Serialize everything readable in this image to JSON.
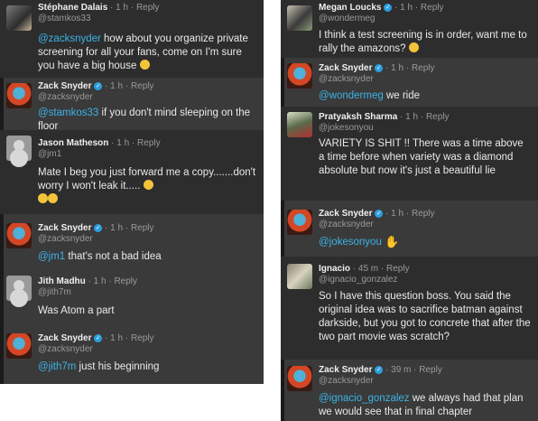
{
  "colors": {
    "background": "#2d2d2d",
    "mention": "#3cb3e8",
    "verified": "#2a9fe0"
  },
  "left": [
    {
      "name": "Stéphane Dalais",
      "meta": " · 1 h · Reply",
      "handle": "@stamkos33",
      "mention": "@zacksnyder",
      "text": "  how about you organize private screening for all your fans, come on I'm sure you have a big house",
      "emoji": "laughing-emoji"
    },
    {
      "name": "Zack Snyder",
      "meta": " · 1 h · Reply",
      "handle": "@zacksnyder",
      "mention": "@stamkos33",
      "text": " if you don't mind sleeping on the floor"
    },
    {
      "name": "Jason Matheson",
      "meta": " · 1 h · Reply",
      "handle": "@jm1",
      "text": "Mate I beg you just forward me a copy.......don't worry I won't leak it.....",
      "emoji": "laughing-emoji"
    },
    {
      "name": "Zack Snyder",
      "meta": " · 1 h · Reply",
      "handle": "@zacksnyder",
      "mention": "@jm1",
      "text": " that's not a bad idea"
    },
    {
      "name": "Jith Madhu",
      "meta": " · 1 h · Reply",
      "handle": "@jith7m",
      "text": "Was Atom a part"
    },
    {
      "name": "Zack Snyder",
      "meta": " · 1 h · Reply",
      "handle": "@zacksnyder",
      "mention": "@jith7m",
      "text": " just his beginning"
    }
  ],
  "right": [
    {
      "name": "Megan Loucks",
      "meta": " · 1 h · Reply",
      "handle": "@wondermeg",
      "text": "I think a test screening is in order, want me to rally the amazons?",
      "emoji": "smirk-emoji"
    },
    {
      "name": "Zack Snyder",
      "meta": " · 1 h · Reply",
      "handle": "@zacksnyder",
      "mention": "@wondermeg",
      "text": " we ride"
    },
    {
      "name": "Pratyaksh Sharma",
      "meta": " · 1 h · Reply",
      "handle": "@jokesonyou",
      "text": "VARIETY IS SHIT !! There was a time above a time before when variety was a diamond absolute but now it's just a beautiful lie"
    },
    {
      "name": "Zack Snyder",
      "meta": " · 1 h · Reply",
      "handle": "@zacksnyder",
      "mention": "@jokesonyou",
      "text": " ",
      "hand": "✋"
    },
    {
      "name": "Ignacio",
      "meta": " · 45 m · Reply",
      "handle": "@ignacio_gonzalez",
      "text": "So I have this question boss. You said the original idea was to sacrifice batman against darkside,  but you got to concrete that after the two part movie was scratch?"
    },
    {
      "name": "Zack Snyder",
      "meta": " · 39 m · Reply",
      "handle": "@zacksnyder",
      "mention": "@ignacio_gonzalez",
      "text": " we always had that plan we would see that in final chapter"
    }
  ]
}
